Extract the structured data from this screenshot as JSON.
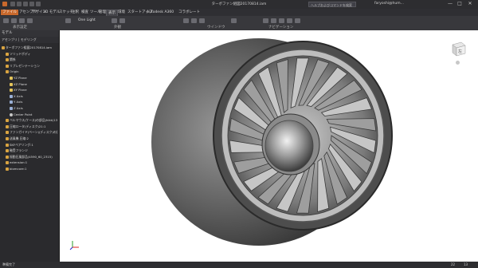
{
  "window": {
    "title": "ターボファン組図20170814.iam",
    "search_placeholder": "ヘルプおよびコマンドを検索",
    "user": "faryoshi@hum...",
    "min": "—",
    "max": "□",
    "close": "✕"
  },
  "menu": {
    "file": "ファイル",
    "tabs": [
      "アセンブリ",
      "デザイン",
      "3D モデル",
      "スケッチ",
      "注釈",
      "検査",
      "ツール",
      "管理",
      "表示",
      "環境",
      "スタートアップ",
      "Autodesk A360",
      "コラボレート"
    ],
    "active_index": 8
  },
  "ribbon": {
    "visual_style": "One Light",
    "groups": [
      "表示設定",
      "外観",
      "ウインドウ",
      "ナビゲーション"
    ]
  },
  "browser": {
    "title": "モデル",
    "tabs": "アセンブリ | モデリング",
    "tree": [
      {
        "label": "ターボファン組図20170814.iam",
        "indent": 0,
        "icon": "assembly"
      },
      {
        "label": "ソリッドボディ",
        "indent": 1,
        "icon": "folder"
      },
      {
        "label": "関係",
        "indent": 1,
        "icon": "folder"
      },
      {
        "label": "リプレゼンテーション",
        "indent": 1,
        "icon": "folder"
      },
      {
        "label": "Origin",
        "indent": 1,
        "icon": "folder"
      },
      {
        "label": "YZ Plane",
        "indent": 2,
        "icon": "plane"
      },
      {
        "label": "XZ Plane",
        "indent": 2,
        "icon": "plane"
      },
      {
        "label": "XY Plane",
        "indent": 2,
        "icon": "plane"
      },
      {
        "label": "X Axis",
        "indent": 2,
        "icon": "axis"
      },
      {
        "label": "Y Axis",
        "indent": 2,
        "icon": "axis"
      },
      {
        "label": "Z Axis",
        "indent": 2,
        "icon": "axis"
      },
      {
        "label": "Center Point",
        "indent": 2,
        "icon": "point"
      },
      {
        "label": "ベルマウス(ケース)の部品(hikk)13",
        "indent": 1,
        "icon": "part"
      },
      {
        "label": "圧縮ロータ(ディスク)21:1",
        "indent": 1,
        "icon": "part"
      },
      {
        "label": "ファンガイド(ベーン)(ディスク)の部品(3:1)",
        "indent": 1,
        "icon": "part"
      },
      {
        "label": "送風機 圧縮:2",
        "indent": 1,
        "icon": "part"
      },
      {
        "label": "SKFベアリング:1",
        "indent": 1,
        "icon": "part"
      },
      {
        "label": "軸受フランジ",
        "indent": 1,
        "icon": "part"
      },
      {
        "label": "振動圧風部品(4590_60_2315)",
        "indent": 1,
        "icon": "part"
      },
      {
        "label": "extension:1",
        "indent": 1,
        "icon": "part"
      },
      {
        "label": "biomcore:1",
        "indent": 1,
        "icon": "part"
      }
    ]
  },
  "status": {
    "left": "準備完了",
    "right1": "22",
    "right2": "13"
  },
  "viewcube": {
    "face": "左"
  }
}
